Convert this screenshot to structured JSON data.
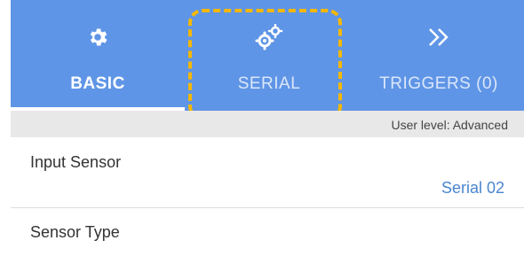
{
  "tabs": [
    {
      "label": "BASIC",
      "icon": "gear-icon"
    },
    {
      "label": "SERIAL",
      "icon": "gears-icon"
    },
    {
      "label": "TRIGGERS (0)",
      "icon": "double-chevron-right-icon"
    }
  ],
  "user_level": "User level: Advanced",
  "rows": [
    {
      "title": "Input Sensor",
      "value": "Serial 02"
    },
    {
      "title": "Sensor Type",
      "value": ""
    }
  ],
  "colors": {
    "header": "#5f95e6",
    "highlight": "#f5b800",
    "value": "#4a86d0"
  }
}
